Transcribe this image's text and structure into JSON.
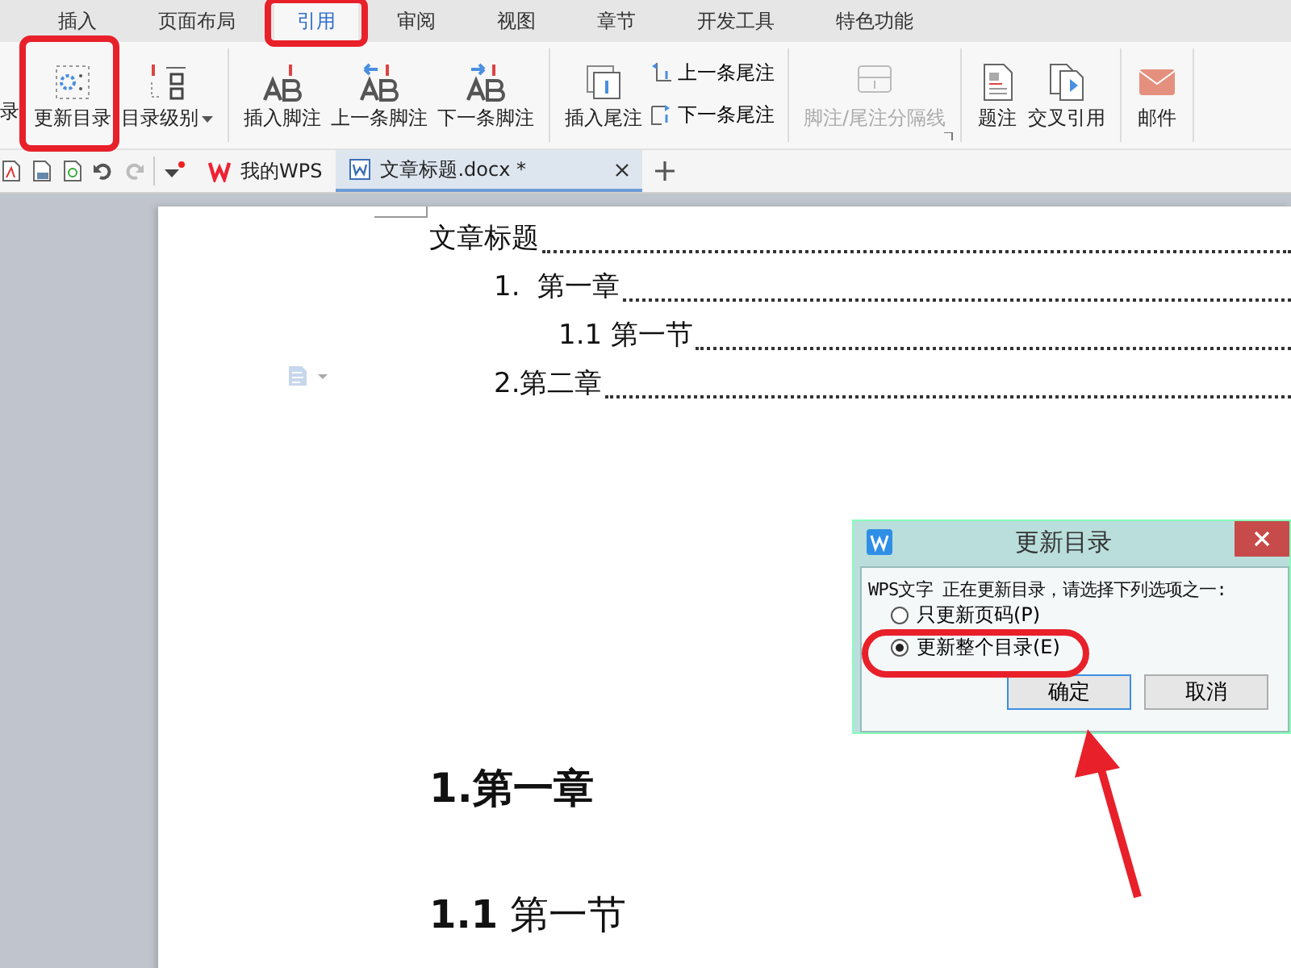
{
  "menu_tabs": [
    {
      "label": "插入",
      "selected": false
    },
    {
      "label": "页面布局",
      "selected": false
    },
    {
      "label": "引用",
      "selected": true,
      "annotated": true
    },
    {
      "label": "审阅",
      "selected": false
    },
    {
      "label": "视图",
      "selected": false
    },
    {
      "label": "章节",
      "selected": false
    },
    {
      "label": "开发工具",
      "selected": false
    },
    {
      "label": "特色功能",
      "selected": false
    }
  ],
  "ribbon": {
    "cut_label": "录",
    "groups": [
      [
        {
          "kind": "large",
          "label": "更新目录",
          "annotated": true
        },
        {
          "kind": "dropdown",
          "label": "目录级别"
        }
      ],
      [
        {
          "kind": "large",
          "label": "插入脚注"
        },
        {
          "kind": "large",
          "label": "上一条脚注"
        },
        {
          "kind": "large",
          "label": "下一条脚注"
        }
      ],
      [
        {
          "kind": "large",
          "label": "插入尾注"
        },
        {
          "kind": "stack",
          "items": [
            "上一条尾注",
            "下一条尾注"
          ]
        }
      ],
      [
        {
          "kind": "disabled",
          "label": "脚注/尾注分隔线"
        }
      ],
      [
        {
          "kind": "large",
          "label": "题注"
        },
        {
          "kind": "large",
          "label": "交叉引用"
        }
      ],
      [
        {
          "kind": "large",
          "label": "邮件"
        }
      ]
    ]
  },
  "doc_tabs": [
    {
      "label": "我的WPS",
      "selected": false
    },
    {
      "label": "文章标题.docx *",
      "selected": true
    }
  ],
  "document": {
    "toc": [
      {
        "text": "文章标题",
        "children": [
          {
            "text": "1.  第一章",
            "children": [
              {
                "text": "1.1 第一节"
              }
            ]
          },
          {
            "text": "2.第二章"
          }
        ]
      }
    ],
    "headings": [
      {
        "kind": "h1",
        "text": "1.第一章"
      },
      {
        "kind": "h2",
        "text": "**1.1** 第一节"
      }
    ]
  },
  "dialog": {
    "title": "更新目录",
    "message": "WPS文字 正在更新目录，请选择下列选项之一:",
    "options": [
      {
        "label": "只更新页码(P)",
        "selected": false
      },
      {
        "label": "更新整个目录(E)",
        "selected": true,
        "annotated": true
      }
    ],
    "buttons": [
      {
        "label": "确定",
        "focused": true
      },
      {
        "label": "取消",
        "focused": false
      }
    ]
  }
}
